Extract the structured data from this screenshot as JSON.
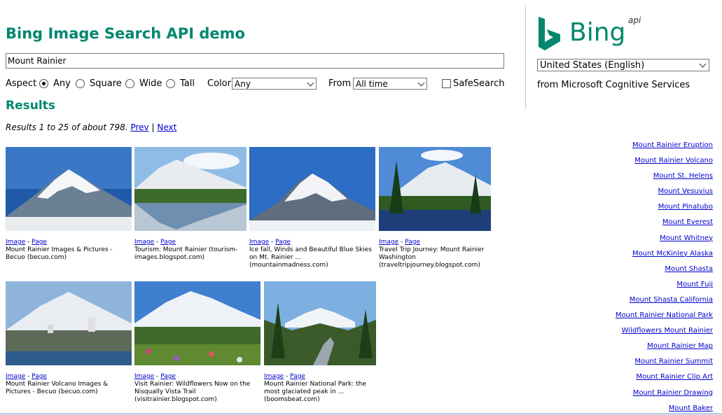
{
  "header": {
    "title": "Bing Image Search API demo",
    "query_value": "Mount Rainier"
  },
  "filters": {
    "aspect_label": "Aspect",
    "aspect_options": [
      "Any",
      "Square",
      "Wide",
      "Tall"
    ],
    "aspect_selected": "Any",
    "color_label": "Color",
    "color_value": "Any",
    "from_label": "From",
    "from_value": "All time",
    "safesearch_label": "SafeSearch"
  },
  "brand": {
    "name": "Bing",
    "suffix": "api",
    "market_value": "United States (English)",
    "tagline": "from Microsoft Cognitive Services",
    "accent_color": "#00876e"
  },
  "results": {
    "heading": "Results",
    "summary": "Results 1 to 25 of about 798.",
    "prev_label": "Prev",
    "separator": "|",
    "next_label": "Next",
    "items": [
      {
        "image_link": "Image",
        "page_link": "Page",
        "caption": "Mount Rainier Images & Pictures - Becuo (becuo.com)"
      },
      {
        "image_link": "Image",
        "page_link": "Page",
        "caption": "Tourism: Mount Rainier (tourism-images.blogspot.com)"
      },
      {
        "image_link": "Image",
        "page_link": "Page",
        "caption": "Ice fall, Winds and Beautiful Blue Skies on Mt. Rainier ... (mountainmadness.com)"
      },
      {
        "image_link": "Image",
        "page_link": "Page",
        "caption": "Travel Trip Journey: Mount Rainier Washington (traveltripjourney.blogspot.com)"
      },
      {
        "image_link": "Image",
        "page_link": "Page",
        "caption": "Mount Rainier Volcano Images & Pictures - Becuo (becuo.com)"
      },
      {
        "image_link": "Image",
        "page_link": "Page",
        "caption": "Visit Rainier: Wildflowers Now on the Nisqually Vista Trail (visitrainier.blogspot.com)"
      },
      {
        "image_link": "Image",
        "page_link": "Page",
        "caption": "Mount Rainier National Park: the most glaciated peak in ... (boomsbeat.com)"
      }
    ]
  },
  "related": [
    "Mount Rainier Eruption",
    "Mount Rainier Volcano",
    "Mount St. Helens",
    "Mount Vesuvius",
    "Mount Pinatubo",
    "Mount Everest",
    "Mount Whitney",
    "Mount McKinley Alaska",
    "Mount Shasta",
    "Mount Fuji",
    "Mount Shasta California",
    "Mount Rainier National Park",
    "Wildflowers Mount Rainier",
    "Mount Rainier Map",
    "Mount Rainier Summit",
    "Mount Rainier Clip Art",
    "Mount Rainier Drawing",
    "Mount Baker"
  ]
}
